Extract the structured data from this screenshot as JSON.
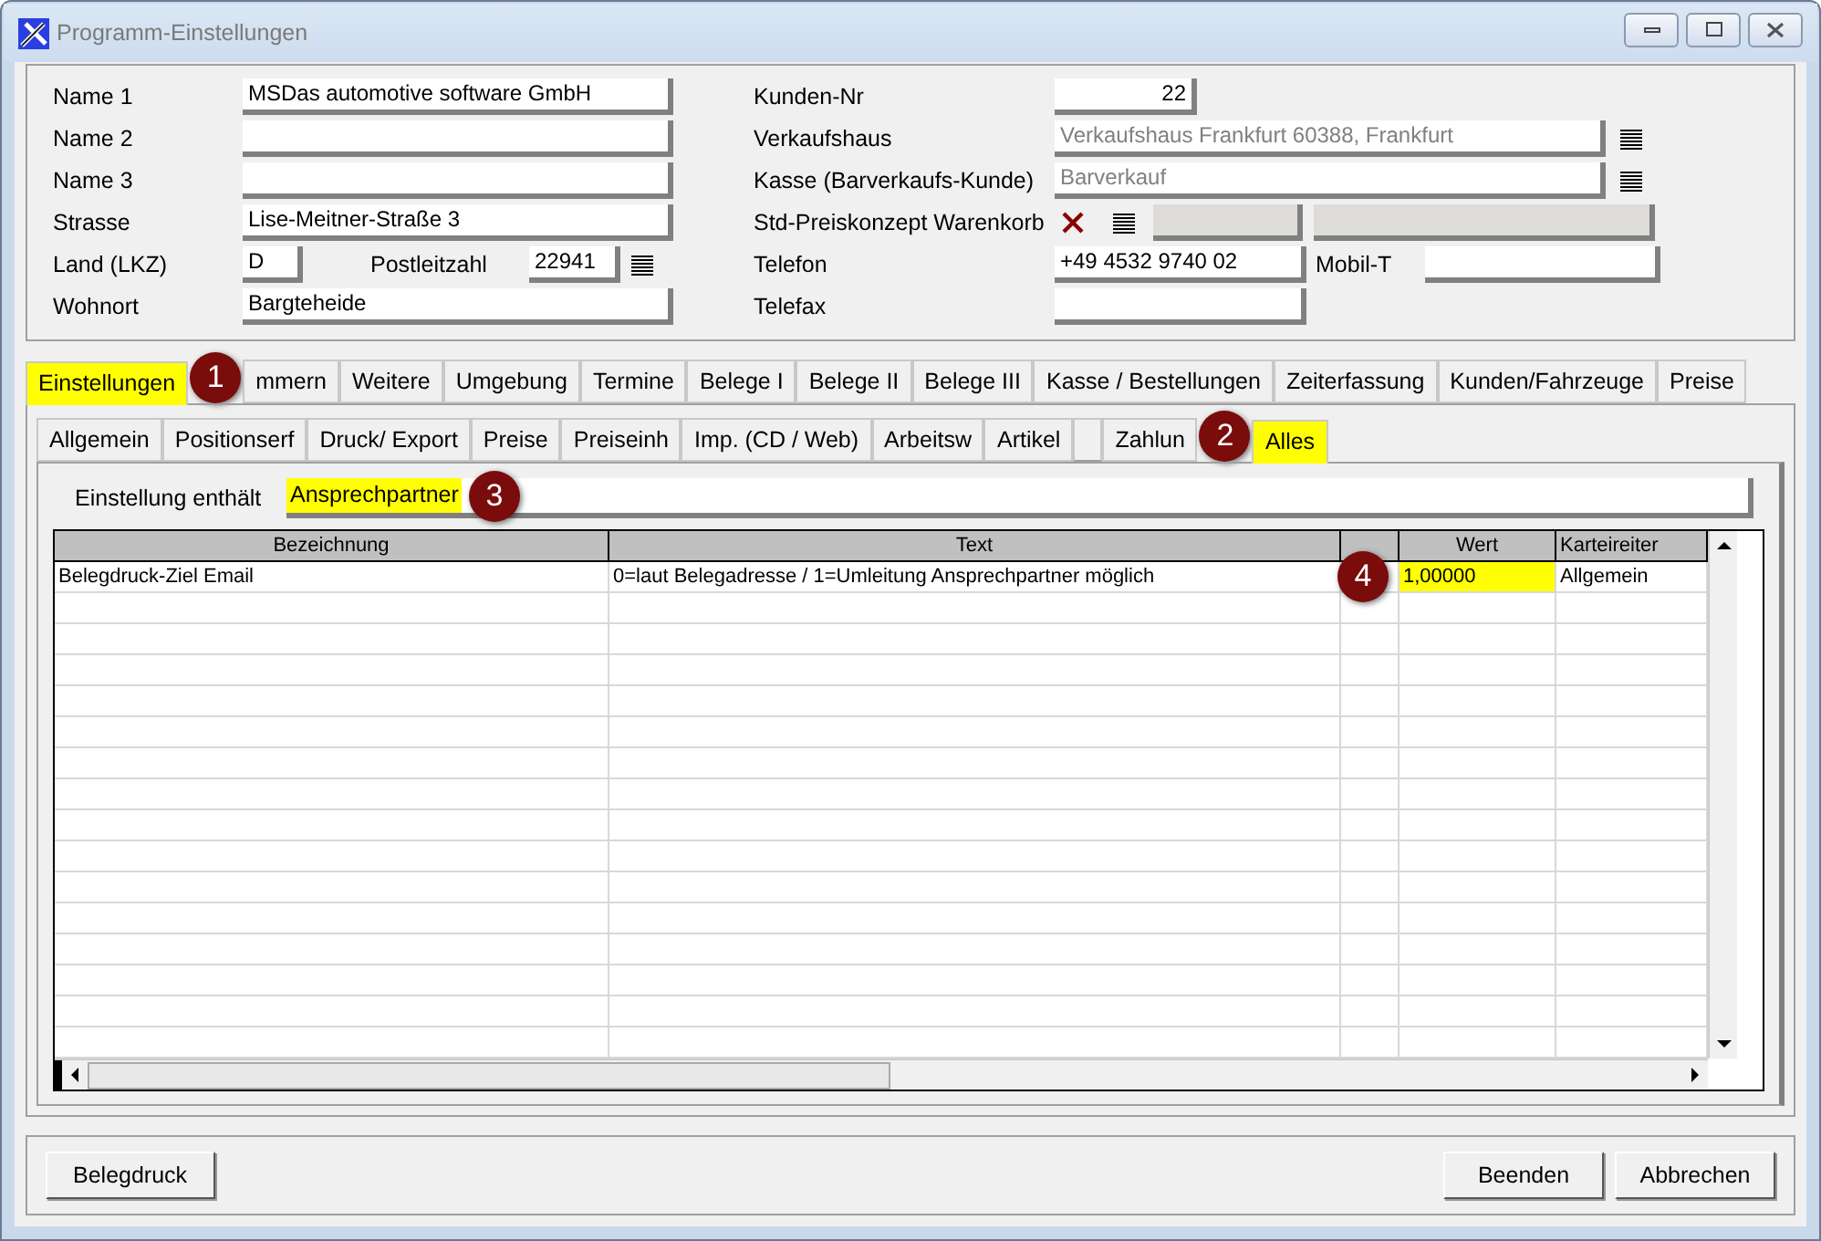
{
  "window": {
    "title": "Programm-Einstellungen"
  },
  "left_fields": [
    {
      "kind": "text",
      "label": "Name 1",
      "value": "MSDas automotive software GmbH"
    },
    {
      "kind": "text",
      "label": "Name 2"
    },
    {
      "kind": "text",
      "label": "Name 3"
    },
    {
      "kind": "text",
      "label": "Strasse",
      "value": "Lise-Meitner-Straße 3"
    },
    {
      "kind": "country",
      "label": "Land (LKZ)",
      "value": "D",
      "postal_label": "Postleitzahl",
      "postal_value": "22941"
    },
    {
      "kind": "text",
      "label": "Wohnort",
      "value": "Bargteheide"
    }
  ],
  "right_fields": [
    {
      "kind": "number",
      "label": "Kunden-Nr",
      "value": "22"
    },
    {
      "kind": "lookup",
      "label": "Verkaufshaus",
      "value": "Verkaufshaus Frankfurt 60388, Frankfurt",
      "disabled": true
    },
    {
      "kind": "lookup",
      "label": "Kasse (Barverkaufs-Kunde)",
      "value": "Barverkauf",
      "disabled": true
    },
    {
      "kind": "price",
      "label": "Std-Preiskonzept Warenkorb"
    },
    {
      "kind": "phone",
      "label": "Telefon",
      "value": "+49 4532 9740 02",
      "mobile_label": "Mobil-T"
    },
    {
      "kind": "short",
      "label": "Telefax"
    }
  ],
  "tabs": [
    {
      "label": "Einstellungen",
      "selected": true,
      "highlighted": true,
      "badge": "1"
    },
    {
      "label": "mmern",
      "selected": false,
      "highlighted": false
    },
    {
      "label": "Weitere",
      "selected": false,
      "highlighted": false
    },
    {
      "label": "Umgebung",
      "selected": false,
      "highlighted": false
    },
    {
      "label": "Termine",
      "selected": false,
      "highlighted": false
    },
    {
      "label": "Belege I",
      "selected": false,
      "highlighted": false
    },
    {
      "label": "Belege II",
      "selected": false,
      "highlighted": false
    },
    {
      "label": "Belege III",
      "selected": false,
      "highlighted": false
    },
    {
      "label": "Kasse / Bestellungen",
      "selected": false,
      "highlighted": false
    },
    {
      "label": "Zeiterfassung",
      "selected": false,
      "highlighted": false
    },
    {
      "label": "Kunden/Fahrzeuge",
      "selected": false,
      "highlighted": false
    },
    {
      "label": "Preise",
      "selected": false,
      "highlighted": false
    }
  ],
  "subtabs": [
    {
      "label": "Allgemein",
      "selected": false,
      "highlighted": false
    },
    {
      "label": "Positionserf",
      "selected": false,
      "highlighted": false
    },
    {
      "label": "Druck/ Export",
      "selected": false,
      "highlighted": false
    },
    {
      "label": "Preise",
      "selected": false,
      "highlighted": false
    },
    {
      "label": "Preiseinh",
      "selected": false,
      "highlighted": false
    },
    {
      "label": "Imp. (CD / Web)",
      "selected": false,
      "highlighted": false
    },
    {
      "label": "Arbeitsw",
      "selected": false,
      "highlighted": false
    },
    {
      "label": "Artikel",
      "selected": false,
      "highlighted": false
    },
    {
      "selected": false,
      "highlighted": false
    },
    {
      "label": "Zahlun",
      "selected": false,
      "highlighted": false,
      "badge": "2"
    },
    {
      "label": "Alles",
      "selected": true,
      "highlighted": true
    }
  ],
  "filter": {
    "label": "Einstellung enthält",
    "value": "Ansprechpartner",
    "highlighted": true,
    "badge": "3"
  },
  "table": {
    "columns": [
      {
        "label": "Bezeichnung"
      },
      {
        "label": "Text"
      },
      {},
      {
        "label": "Wert"
      },
      {
        "label": "Karteireiter"
      }
    ],
    "rows": [
      {
        "cells": [
          {
            "text": "Belegdruck-Ziel Email",
            "highlighted": false
          },
          {
            "text": "0=laut Belegadresse / 1=Umleitung Ansprechpartner möglich",
            "highlighted": false
          },
          {
            "highlighted": false
          },
          {
            "text": "1,00000",
            "highlighted": true
          },
          {
            "text": "Allgemein",
            "highlighted": false
          }
        ],
        "badge": "4"
      }
    ]
  },
  "buttons_left": [
    "Belegdruck"
  ],
  "buttons_right": [
    "Beenden",
    "Abbrechen"
  ]
}
